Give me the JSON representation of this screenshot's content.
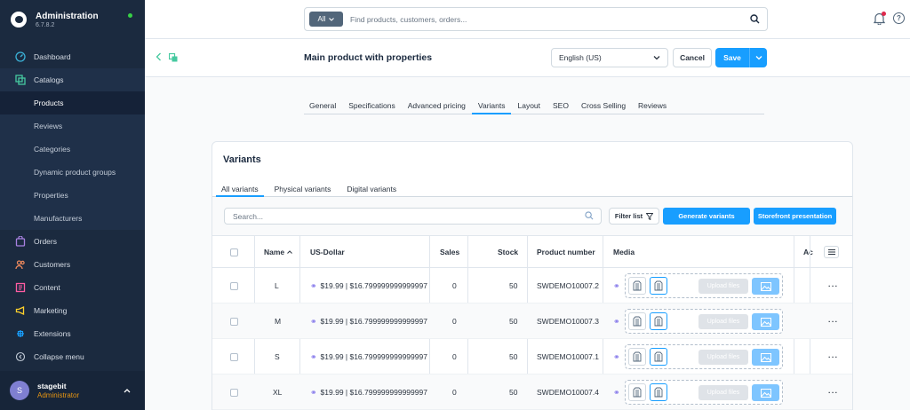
{
  "sidebar": {
    "brand_title": "Administration",
    "brand_version": "6.7.8.2",
    "items": [
      {
        "label": "Dashboard",
        "icon": "dashboard-icon"
      },
      {
        "label": "Catalogs",
        "icon": "catalogs-icon"
      },
      {
        "label": "Products"
      },
      {
        "label": "Reviews"
      },
      {
        "label": "Categories"
      },
      {
        "label": "Dynamic product groups"
      },
      {
        "label": "Properties"
      },
      {
        "label": "Manufacturers"
      },
      {
        "label": "Orders",
        "icon": "orders-icon"
      },
      {
        "label": "Customers",
        "icon": "customers-icon"
      },
      {
        "label": "Content",
        "icon": "content-icon"
      },
      {
        "label": "Marketing",
        "icon": "marketing-icon"
      },
      {
        "label": "Extensions",
        "icon": "extensions-icon"
      },
      {
        "label": "Collapse menu",
        "icon": "collapse-icon"
      }
    ],
    "user": {
      "initial": "S",
      "name": "stagebit",
      "role": "Administrator"
    }
  },
  "topbar": {
    "search_scope": "All",
    "search_placeholder": "Find products, customers, orders..."
  },
  "smartbar": {
    "title": "Main product with properties",
    "language": "English (US)",
    "cancel_label": "Cancel",
    "save_label": "Save"
  },
  "tabs": [
    "General",
    "Specifications",
    "Advanced pricing",
    "Variants",
    "Layout",
    "SEO",
    "Cross Selling",
    "Reviews"
  ],
  "active_tab": "Variants",
  "variants": {
    "title": "Variants",
    "subtabs": [
      "All variants",
      "Physical variants",
      "Digital variants"
    ],
    "search_placeholder": "Search...",
    "filter_label": "Filter list",
    "generate_label": "Generate variants",
    "storefront_label": "Storefront presentation",
    "columns": {
      "name": "Name",
      "price": "US-Dollar",
      "sales": "Sales",
      "stock": "Stock",
      "number": "Product number",
      "media": "Media",
      "active": "Ac"
    },
    "upload_label": "Upload files",
    "rows": [
      {
        "name": "L",
        "price": "$19.99 | $16.799999999999997",
        "sales": "0",
        "stock": "50",
        "number": "SWDEMO10007.2"
      },
      {
        "name": "M",
        "price": "$19.99 | $16.799999999999997",
        "sales": "0",
        "stock": "50",
        "number": "SWDEMO10007.3"
      },
      {
        "name": "S",
        "price": "$19.99 | $16.799999999999997",
        "sales": "0",
        "stock": "50",
        "number": "SWDEMO10007.1"
      },
      {
        "name": "XL",
        "price": "$19.99 | $16.799999999999997",
        "sales": "0",
        "stock": "50",
        "number": "SWDEMO10007.4"
      }
    ]
  },
  "colors": {
    "sidebar": "#1b2a3f",
    "accent": "#189eff",
    "role": "#e69512"
  }
}
